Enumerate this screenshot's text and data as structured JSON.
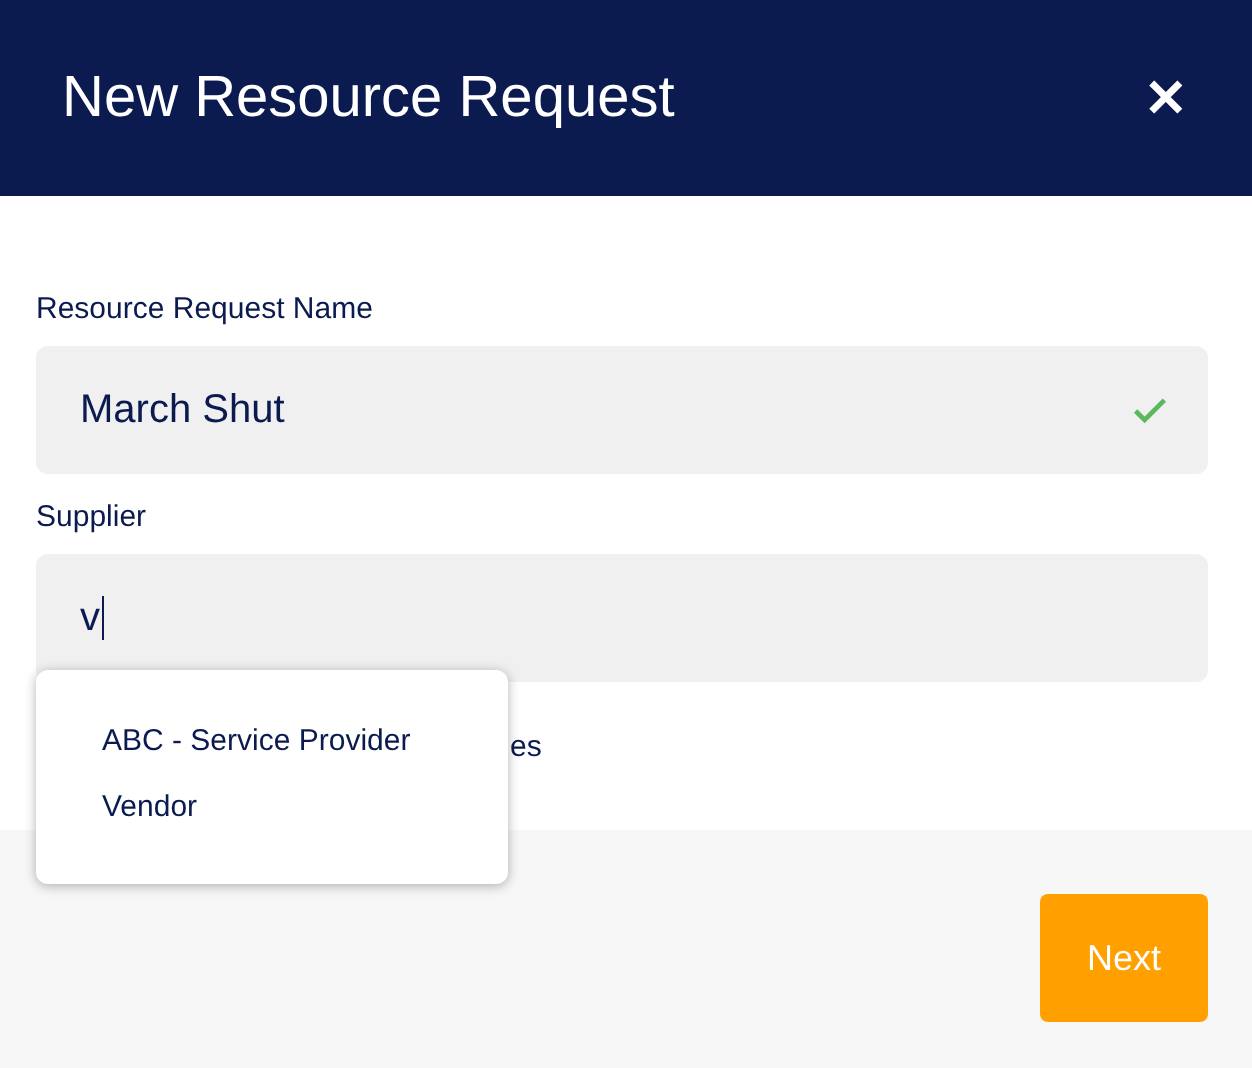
{
  "window": {
    "title": "New Resource Request",
    "close": "✕"
  },
  "fields": [
    {
      "label": "Resource Request Name",
      "value": "March Shut",
      "valid": true,
      "focused": false
    },
    {
      "label": "Supplier",
      "value": "v",
      "valid": false,
      "focused": true
    }
  ],
  "dropdown": {
    "options": [
      {
        "label": "ABC - Service Provider",
        "selected": false
      },
      {
        "label": "Vendor",
        "selected": false
      }
    ]
  },
  "covered_text": "es",
  "buttons": [
    {
      "label": "Next"
    }
  ]
}
